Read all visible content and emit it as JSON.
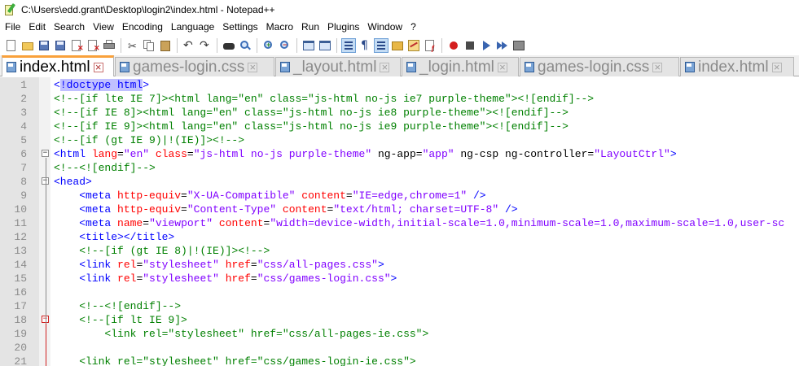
{
  "window": {
    "title": "C:\\Users\\edd.grant\\Desktop\\login2\\index.html - Notepad++"
  },
  "menu": [
    "File",
    "Edit",
    "Search",
    "View",
    "Encoding",
    "Language",
    "Settings",
    "Macro",
    "Run",
    "Plugins",
    "Window",
    "?"
  ],
  "toolbar": {
    "icons": [
      "new-file",
      "open-file",
      "save",
      "save-all",
      "close",
      "close-all",
      "print",
      "cut",
      "copy",
      "paste",
      "undo",
      "redo",
      "find",
      "replace",
      "zoom-in",
      "zoom-out",
      "sync-vertical",
      "sync-horizontal",
      "word-wrap",
      "show-all-chars",
      "indent-guide",
      "user-defined-language",
      "doc-map",
      "function-list",
      "folder-as-workspace",
      "monitoring",
      "record-macro",
      "stop-macro",
      "play-macro",
      "run-macro-multiple",
      "save-macro"
    ]
  },
  "tabs": [
    {
      "label": "index.html",
      "active": true
    },
    {
      "label": "games-login.css",
      "active": false
    },
    {
      "label": "_layout.html",
      "active": false
    },
    {
      "label": "_login.html",
      "active": false
    },
    {
      "label": "games-login.css",
      "active": false
    },
    {
      "label": "index.html",
      "active": false
    }
  ],
  "code_lines": [
    {
      "n": "1",
      "segments": [
        {
          "c": "tag",
          "t": "<"
        },
        {
          "c": "tag hl",
          "t": "!doctype html"
        },
        {
          "c": "tag",
          "t": ">"
        }
      ]
    },
    {
      "n": "2",
      "segments": [
        {
          "c": "cmt",
          "t": "<!--[if lte IE 7]><html lang=\"en\" class=\"js-html no-js ie7 purple-theme\"><![endif]-->"
        }
      ]
    },
    {
      "n": "3",
      "segments": [
        {
          "c": "cmt",
          "t": "<!--[if IE 8]><html lang=\"en\" class=\"js-html no-js ie8 purple-theme\"><![endif]-->"
        }
      ]
    },
    {
      "n": "4",
      "segments": [
        {
          "c": "cmt",
          "t": "<!--[if IE 9]><html lang=\"en\" class=\"js-html no-js ie9 purple-theme\"><![endif]-->"
        }
      ]
    },
    {
      "n": "5",
      "segments": [
        {
          "c": "cmt",
          "t": "<!--[if (gt IE 9)|!(IE)]><!-->"
        }
      ]
    },
    {
      "n": "6",
      "segments": [
        {
          "c": "tag",
          "t": "<html "
        },
        {
          "c": "attr",
          "t": "lang"
        },
        {
          "c": "txt",
          "t": "="
        },
        {
          "c": "val",
          "t": "\"en\""
        },
        {
          "c": "txt",
          "t": " "
        },
        {
          "c": "attr",
          "t": "class"
        },
        {
          "c": "txt",
          "t": "="
        },
        {
          "c": "val",
          "t": "\"js-html no-js purple-theme\""
        },
        {
          "c": "txt",
          "t": " ng-app="
        },
        {
          "c": "val",
          "t": "\"app\""
        },
        {
          "c": "txt",
          "t": " ng-csp ng-controller="
        },
        {
          "c": "val",
          "t": "\"LayoutCtrl\""
        },
        {
          "c": "tag",
          "t": ">"
        }
      ]
    },
    {
      "n": "7",
      "segments": [
        {
          "c": "cmt",
          "t": "<!--<![endif]-->"
        }
      ]
    },
    {
      "n": "8",
      "segments": [
        {
          "c": "tag",
          "t": "<head>"
        }
      ]
    },
    {
      "n": "9",
      "segments": [
        {
          "c": "txt",
          "t": "    "
        },
        {
          "c": "tag",
          "t": "<meta "
        },
        {
          "c": "attr",
          "t": "http-equiv"
        },
        {
          "c": "txt",
          "t": "="
        },
        {
          "c": "val",
          "t": "\"X-UA-Compatible\""
        },
        {
          "c": "txt",
          "t": " "
        },
        {
          "c": "attr",
          "t": "content"
        },
        {
          "c": "txt",
          "t": "="
        },
        {
          "c": "val",
          "t": "\"IE=edge,chrome=1\""
        },
        {
          "c": "txt",
          "t": " "
        },
        {
          "c": "tag",
          "t": "/>"
        }
      ]
    },
    {
      "n": "10",
      "segments": [
        {
          "c": "txt",
          "t": "    "
        },
        {
          "c": "tag",
          "t": "<meta "
        },
        {
          "c": "attr",
          "t": "http-equiv"
        },
        {
          "c": "txt",
          "t": "="
        },
        {
          "c": "val",
          "t": "\"Content-Type\""
        },
        {
          "c": "txt",
          "t": " "
        },
        {
          "c": "attr",
          "t": "content"
        },
        {
          "c": "txt",
          "t": "="
        },
        {
          "c": "val",
          "t": "\"text/html; charset=UTF-8\""
        },
        {
          "c": "txt",
          "t": " "
        },
        {
          "c": "tag",
          "t": "/>"
        }
      ]
    },
    {
      "n": "11",
      "segments": [
        {
          "c": "txt",
          "t": "    "
        },
        {
          "c": "tag",
          "t": "<meta "
        },
        {
          "c": "attr",
          "t": "name"
        },
        {
          "c": "txt",
          "t": "="
        },
        {
          "c": "val",
          "t": "\"viewport\""
        },
        {
          "c": "txt",
          "t": " "
        },
        {
          "c": "attr",
          "t": "content"
        },
        {
          "c": "txt",
          "t": "="
        },
        {
          "c": "val",
          "t": "\"width=device-width,initial-scale=1.0,minimum-scale=1.0,maximum-scale=1.0,user-sc"
        }
      ]
    },
    {
      "n": "12",
      "segments": [
        {
          "c": "txt",
          "t": "    "
        },
        {
          "c": "tag",
          "t": "<title></title>"
        }
      ]
    },
    {
      "n": "13",
      "segments": [
        {
          "c": "txt",
          "t": "    "
        },
        {
          "c": "cmt",
          "t": "<!--[if (gt IE 8)|!(IE)]><!-->"
        }
      ]
    },
    {
      "n": "14",
      "segments": [
        {
          "c": "txt",
          "t": "    "
        },
        {
          "c": "tag",
          "t": "<link "
        },
        {
          "c": "attr",
          "t": "rel"
        },
        {
          "c": "txt",
          "t": "="
        },
        {
          "c": "val",
          "t": "\"stylesheet\""
        },
        {
          "c": "txt",
          "t": " "
        },
        {
          "c": "attr",
          "t": "href"
        },
        {
          "c": "txt",
          "t": "="
        },
        {
          "c": "val",
          "t": "\"css/all-pages.css\""
        },
        {
          "c": "tag",
          "t": ">"
        }
      ]
    },
    {
      "n": "15",
      "segments": [
        {
          "c": "txt",
          "t": "    "
        },
        {
          "c": "tag",
          "t": "<link "
        },
        {
          "c": "attr",
          "t": "rel"
        },
        {
          "c": "txt",
          "t": "="
        },
        {
          "c": "val",
          "t": "\"stylesheet\""
        },
        {
          "c": "txt",
          "t": " "
        },
        {
          "c": "attr",
          "t": "href"
        },
        {
          "c": "txt",
          "t": "="
        },
        {
          "c": "val",
          "t": "\"css/games-login.css\""
        },
        {
          "c": "tag",
          "t": ">"
        }
      ]
    },
    {
      "n": "16",
      "segments": [
        {
          "c": "txt",
          "t": ""
        }
      ]
    },
    {
      "n": "17",
      "segments": [
        {
          "c": "txt",
          "t": "    "
        },
        {
          "c": "cmt",
          "t": "<!--<![endif]-->"
        }
      ]
    },
    {
      "n": "18",
      "segments": [
        {
          "c": "txt",
          "t": "    "
        },
        {
          "c": "cmt",
          "t": "<!--[if lt IE 9]>"
        }
      ]
    },
    {
      "n": "19",
      "segments": [
        {
          "c": "cmt",
          "t": "        <link rel=\"stylesheet\" href=\"css/all-pages-ie.css\">"
        }
      ]
    },
    {
      "n": "20",
      "segments": [
        {
          "c": "txt",
          "t": ""
        }
      ]
    },
    {
      "n": "21",
      "segments": [
        {
          "c": "cmt",
          "t": "    <link rel=\"stylesheet\" href=\"css/games-login-ie.css\">"
        }
      ]
    }
  ],
  "colors": {
    "tag": "#0000ff",
    "attribute": "#ff0000",
    "value": "#8000ff",
    "comment": "#008000",
    "active_tab_accent": "#f9a13b"
  }
}
